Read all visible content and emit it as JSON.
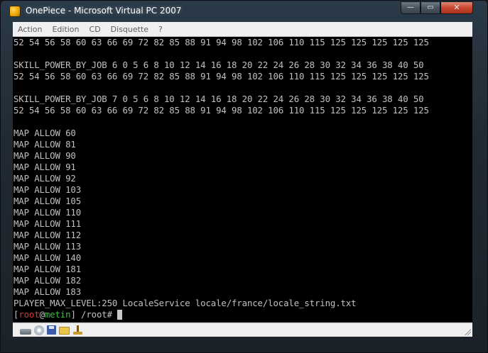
{
  "window": {
    "title": "OnePiece - Microsoft Virtual PC 2007",
    "buttons": {
      "minimize": "—",
      "maximize": "▭",
      "close": "✕"
    }
  },
  "menu": [
    "Action",
    "Edition",
    "CD",
    "Disquette",
    "?"
  ],
  "terminal": {
    "lines": [
      "52 54 56 58 60 63 66 69 72 82 85 88 91 94 98 102 106 110 115 125 125 125 125 125",
      "",
      "SKILL_POWER_BY_JOB 6 0 5 6 8 10 12 14 16 18 20 22 24 26 28 30 32 34 36 38 40 50",
      "52 54 56 58 60 63 66 69 72 82 85 88 91 94 98 102 106 110 115 125 125 125 125 125",
      "",
      "SKILL_POWER_BY_JOB 7 0 5 6 8 10 12 14 16 18 20 22 24 26 28 30 32 34 36 38 40 50",
      "52 54 56 58 60 63 66 69 72 82 85 88 91 94 98 102 106 110 115 125 125 125 125 125",
      "",
      "MAP ALLOW 60",
      "MAP ALLOW 81",
      "MAP ALLOW 90",
      "MAP ALLOW 91",
      "MAP ALLOW 92",
      "MAP ALLOW 103",
      "MAP ALLOW 105",
      "MAP ALLOW 110",
      "MAP ALLOW 111",
      "MAP ALLOW 112",
      "MAP ALLOW 113",
      "MAP ALLOW 140",
      "MAP ALLOW 181",
      "MAP ALLOW 182",
      "MAP ALLOW 183",
      "PLAYER_MAX_LEVEL:250 LocaleService locale/france/locale_string.txt"
    ],
    "prompt": {
      "open": "[",
      "user": "root",
      "at": "@",
      "host": "metin",
      "path": "] /root#"
    },
    "colors": {
      "background": "#000000",
      "text": "#c0c0c0",
      "user": "#d23a3a",
      "host": "#3fb94a"
    }
  },
  "statusbar": {
    "icons": [
      "network-icon",
      "cd-icon",
      "floppy-icon",
      "shared-folder-icon",
      "usb-icon"
    ]
  }
}
